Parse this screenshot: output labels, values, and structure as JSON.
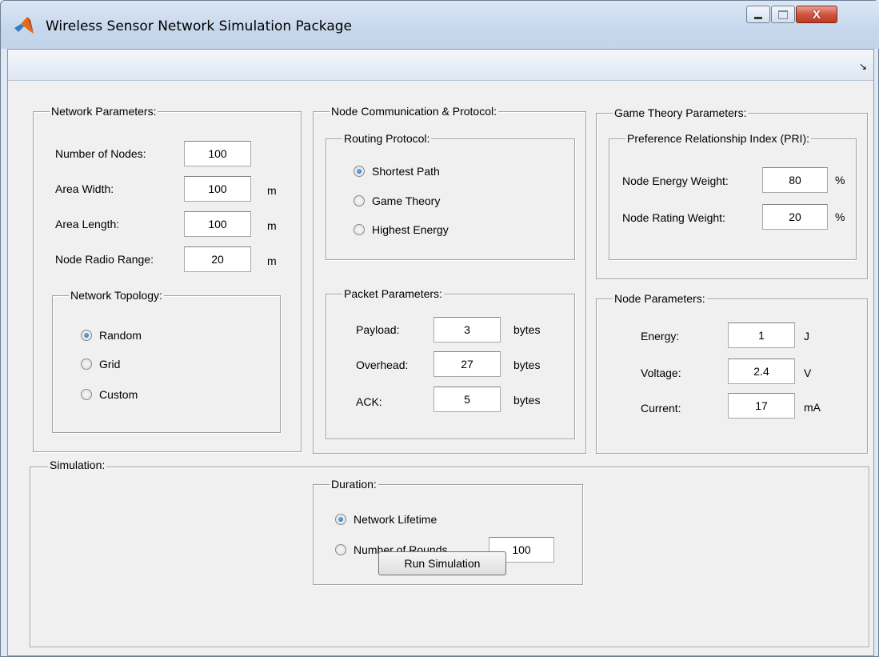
{
  "window": {
    "title": "Wireless Sensor Network Simulation Package",
    "controls": {
      "minimize": "minimize",
      "maximize": "maximize",
      "close": "X"
    },
    "undock_icon": "↘"
  },
  "network": {
    "legend": "Network Parameters:",
    "nodes_label": "Number of Nodes:",
    "nodes_value": "100",
    "width_label": "Area Width:",
    "width_value": "100",
    "width_unit": "m",
    "length_label": "Area Length:",
    "length_value": "100",
    "length_unit": "m",
    "range_label": "Node Radio Range:",
    "range_value": "20",
    "range_unit": "m",
    "topology": {
      "legend": "Network Topology:",
      "options": [
        "Random",
        "Grid",
        "Custom"
      ],
      "selected": "Random"
    }
  },
  "comm": {
    "legend": "Node Communication & Protocol:",
    "routing": {
      "legend": "Routing Protocol:",
      "options": [
        "Shortest Path",
        "Game Theory",
        "Highest Energy"
      ],
      "selected": "Shortest Path"
    },
    "packet": {
      "legend": "Packet Parameters:",
      "payload_label": "Payload:",
      "payload_value": "3",
      "payload_unit": "bytes",
      "overhead_label": "Overhead:",
      "overhead_value": "27",
      "overhead_unit": "bytes",
      "ack_label": "ACK:",
      "ack_value": "5",
      "ack_unit": "bytes"
    }
  },
  "game": {
    "legend": "Game Theory Parameters:",
    "pri": {
      "legend": "Preference Relationship Index (PRI):",
      "energy_label": "Node Energy Weight:",
      "energy_value": "80",
      "energy_unit": "%",
      "rating_label": "Node Rating Weight:",
      "rating_value": "20",
      "rating_unit": "%"
    }
  },
  "node": {
    "legend": "Node Parameters:",
    "energy_label": "Energy:",
    "energy_value": "1",
    "energy_unit": "J",
    "voltage_label": "Voltage:",
    "voltage_value": "2.4",
    "voltage_unit": "V",
    "current_label": "Current:",
    "current_value": "17",
    "current_unit": "mA"
  },
  "simulation": {
    "legend": "Simulation:",
    "duration": {
      "legend": "Duration:",
      "options": [
        "Network Lifetime",
        "Number of Rounds"
      ],
      "selected": "Network Lifetime",
      "rounds_value": "100"
    },
    "run_label": "Run Simulation"
  }
}
